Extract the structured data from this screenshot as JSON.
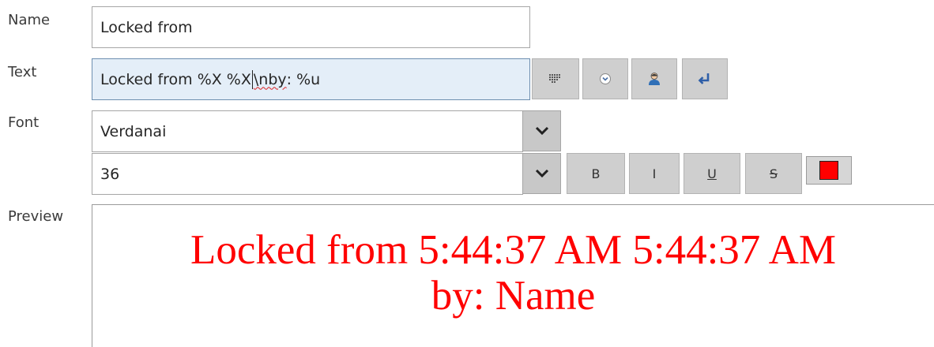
{
  "labels": {
    "name": "Name",
    "text": "Text",
    "font": "Font",
    "preview": "Preview"
  },
  "name_field": {
    "value": "Locked from"
  },
  "text_field": {
    "value_before_caret": "Locked from %X %X",
    "value_after_caret_misspelled": "\\nby",
    "value_after_caret_rest": ": %u"
  },
  "text_toolbar": {
    "icons": [
      "grid-icon",
      "dropdown-circle-icon",
      "user-icon",
      "newline-return-icon"
    ]
  },
  "font_family_select": {
    "value": "Verdanai"
  },
  "font_size_select": {
    "value": "36"
  },
  "style_buttons": {
    "bold_label": "B",
    "italic_label": "I",
    "underline_label": "U",
    "strikethrough_label": "S"
  },
  "color": {
    "text_color": "#ff0000"
  },
  "preview": {
    "line1": "Locked from 5:44:37 AM 5:44:37 AM",
    "line2": "by: Name"
  }
}
